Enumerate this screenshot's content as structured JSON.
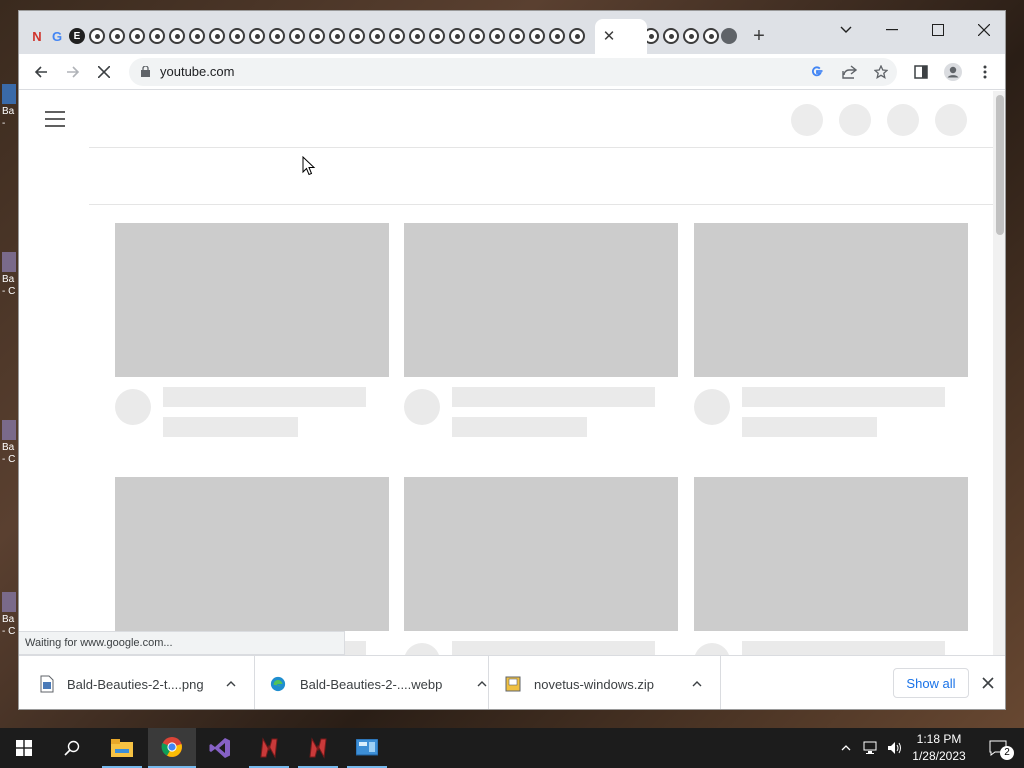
{
  "desktop": {
    "icons": [
      {
        "label": "Ba\n-"
      },
      {
        "label": "Ba\n- C"
      },
      {
        "label": "Ba\n- C"
      },
      {
        "label": "Ba\n- C"
      }
    ]
  },
  "browser": {
    "tabs": [
      {
        "icon": "netflix-n-icon",
        "glyph": "N"
      },
      {
        "icon": "google-g-icon",
        "glyph": "G"
      },
      {
        "icon": "e-icon",
        "glyph": "E"
      }
    ],
    "active_tab_close": "✕",
    "new_tab": "+",
    "url": "youtube.com",
    "status_text": "Waiting for www.google.com..."
  },
  "downloads": {
    "items": [
      {
        "name": "Bald-Beauties-2-t....png",
        "icon": "image-file-icon"
      },
      {
        "name": "Bald-Beauties-2-....webp",
        "icon": "edge-icon"
      },
      {
        "name": "novetus-windows.zip",
        "icon": "zip-file-icon"
      }
    ],
    "show_all": "Show all"
  },
  "taskbar": {
    "time": "1:18 PM",
    "date": "1/28/2023",
    "notification_count": "2"
  },
  "colors": {
    "skeleton_thumb": "#cccccc",
    "skeleton_line": "#eaeaea",
    "link_blue": "#1a73e8",
    "taskbar": "#1c1c1c"
  }
}
